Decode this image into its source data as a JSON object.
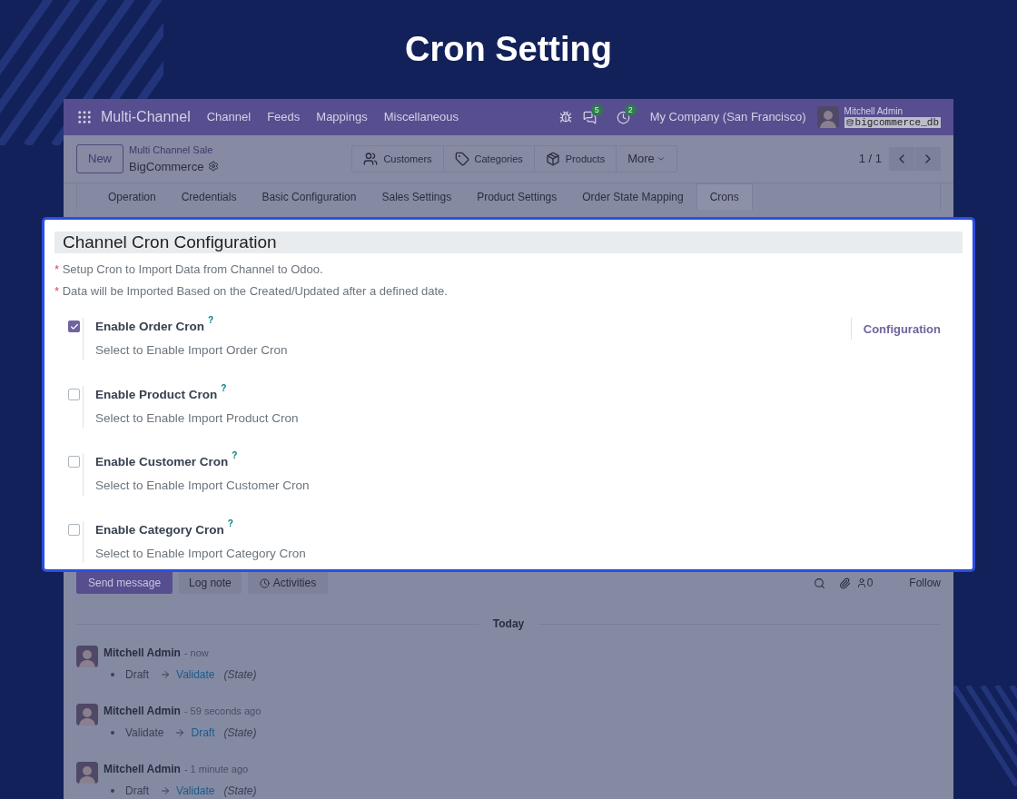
{
  "page_title": "Cron Setting",
  "navbar": {
    "app_name": "Multi-Channel",
    "menu": [
      "Channel",
      "Feeds",
      "Mappings",
      "Miscellaneous"
    ],
    "message_count": "5",
    "activity_count": "2",
    "company": "My Company (San Francisco)",
    "user": "Mitchell Admin",
    "database": "bigcommerce_db"
  },
  "control_panel": {
    "new_button": "New",
    "breadcrumb": "Multi Channel Sale",
    "record_name": "BigCommerce",
    "smart_buttons": [
      {
        "kind": "customers",
        "label": "Customers"
      },
      {
        "kind": "categories",
        "label": "Categories"
      },
      {
        "kind": "products",
        "label": "Products"
      }
    ],
    "more_button": "More",
    "pager": "1 / 1"
  },
  "tabs": [
    {
      "label": "Operation",
      "selected": false
    },
    {
      "label": "Credentials",
      "selected": false
    },
    {
      "label": "Basic Configuration",
      "selected": false
    },
    {
      "label": "Sales Settings",
      "selected": false
    },
    {
      "label": "Product Settings",
      "selected": false
    },
    {
      "label": "Order State Mapping",
      "selected": false
    },
    {
      "label": "Crons",
      "selected": true
    }
  ],
  "cron_config": {
    "title": "Channel Cron Configuration",
    "notes": [
      {
        "mark": "*",
        "text": "Setup Cron to Import Data from Channel to Odoo."
      },
      {
        "mark": "*",
        "text": "Data will be Imported Based on the Created/Updated after a defined date."
      }
    ],
    "options": [
      {
        "label": "Enable Order Cron",
        "help": "?",
        "description": "Select to Enable Import Order Cron",
        "checked": true,
        "link": "Configuration"
      },
      {
        "label": "Enable Product Cron",
        "help": "?",
        "description": "Select to Enable Import Product Cron",
        "checked": false
      },
      {
        "label": "Enable Customer Cron",
        "help": "?",
        "description": "Select to Enable Import Customer Cron",
        "checked": false
      },
      {
        "label": "Enable Category Cron",
        "help": "?",
        "description": "Select to Enable Import Category Cron",
        "checked": false
      }
    ]
  },
  "chatter": {
    "send_message": "Send message",
    "log_note": "Log note",
    "activities": "Activities",
    "follower_count": "0",
    "follow": "Follow",
    "date_separator": "Today",
    "messages": [
      {
        "author": "Mitchell Admin",
        "time": "- now",
        "old_value": "Draft",
        "new_value": "Validate",
        "field": "(State)"
      },
      {
        "author": "Mitchell Admin",
        "time": "- 59 seconds ago",
        "old_value": "Validate",
        "new_value": "Draft",
        "field": "(State)"
      },
      {
        "author": "Mitchell Admin",
        "time": "- 1 minute ago",
        "old_value": "Draft",
        "new_value": "Validate",
        "field": "(State)"
      }
    ]
  }
}
